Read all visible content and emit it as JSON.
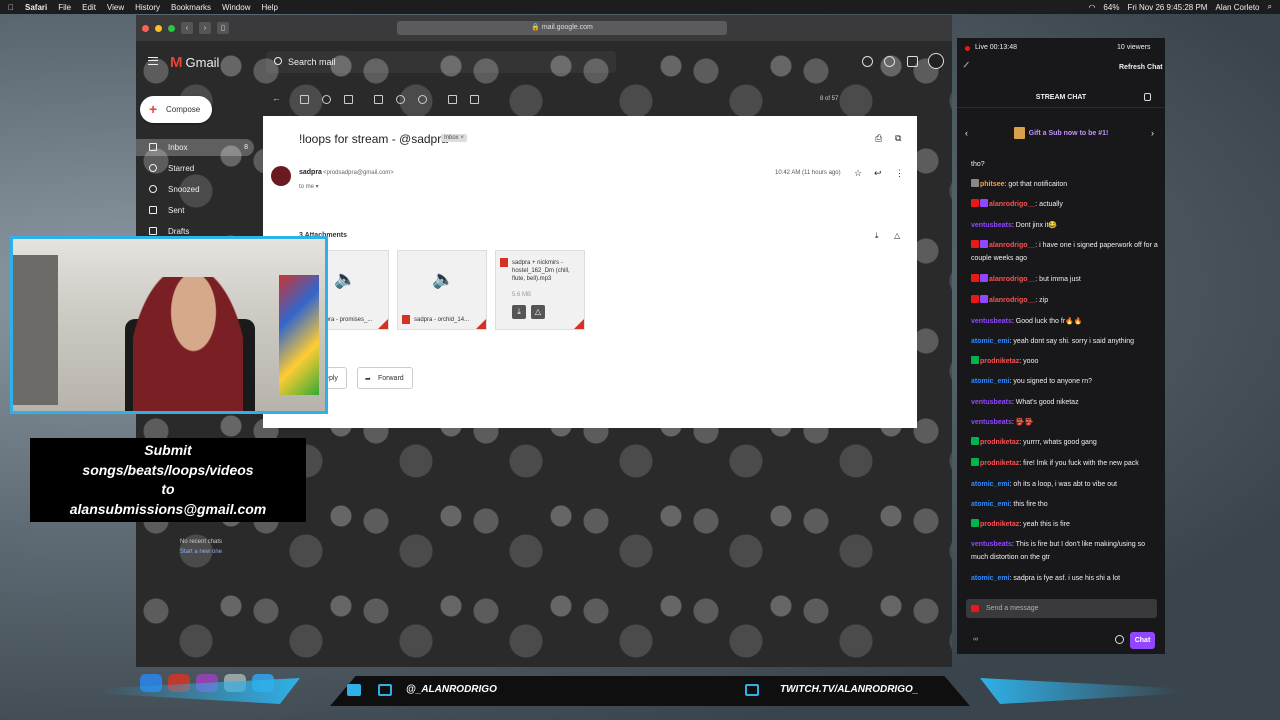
{
  "menubar": {
    "app": "Safari",
    "items": [
      "File",
      "Edit",
      "View",
      "History",
      "Bookmarks",
      "Window",
      "Help"
    ],
    "battery": "64%",
    "datetime": "Fri Nov 26  9:45:28 PM",
    "user": "Alan Corleto"
  },
  "safari": {
    "url": "mail.google.com"
  },
  "gmail": {
    "logo": "Gmail",
    "search_placeholder": "Search mail",
    "compose_label": "Compose",
    "nav": [
      {
        "label": "Inbox",
        "count": "8"
      },
      {
        "label": "Starred"
      },
      {
        "label": "Snoozed"
      },
      {
        "label": "Sent"
      },
      {
        "label": "Drafts"
      }
    ],
    "pagination": "8 of 57",
    "message": {
      "subject": "!loops for stream - @sadpra",
      "badge": "Inbox ×",
      "sender_name": "sadpra",
      "sender_email": "<prodsadpra@gmail.com>",
      "to": "to me ▾",
      "timestamp": "10:42 AM (11 hours ago)",
      "attachments_header": "3 Attachments",
      "attachments": [
        {
          "label": "sadpra - promises_..."
        },
        {
          "label": "sadpra - orchid_14..."
        },
        {
          "title": "sadpra + nickmirs - hostel_162_Dm (chill, flute, bell).mp3",
          "size": "5.6 MB"
        }
      ],
      "reply_label": "Reply",
      "forward_label": "Forward"
    },
    "chats": {
      "none": "No recent chats",
      "start": "Start a new one"
    }
  },
  "overlay": {
    "submit_lines": [
      "Submit",
      "songs/beats/loops/videos",
      "to",
      "alansubmissions@gmail.com"
    ],
    "twitter": "@_ALANRODRIGO",
    "twitch": "TWITCH.TV/ALANRODRIGO_"
  },
  "chat": {
    "live_time": "Live 00:13:48",
    "viewers": "10 viewers",
    "refresh": "Refresh Chat",
    "header": "STREAM CHAT",
    "sub_banner": "Gift a Sub now to be #1!",
    "messages": [
      {
        "user": "",
        "text": "tho?",
        "color": "#efeff1",
        "badges": []
      },
      {
        "user": "phitsee",
        "text": ": got that notificaiton",
        "color": "#ff9e3d",
        "badges": [
          "gray"
        ]
      },
      {
        "user": "alanrodrigo__",
        "text": ": actually",
        "color": "#ff4f4f",
        "badges": [
          "red",
          "purple"
        ]
      },
      {
        "user": "ventusbeats",
        "text": ": Dont jinx it😂",
        "color": "#9147ff",
        "badges": []
      },
      {
        "user": "alanrodrigo__",
        "text": ": i have one i signed paperwork off for a couple weeks ago",
        "color": "#ff4f4f",
        "badges": [
          "red",
          "purple"
        ]
      },
      {
        "user": "alanrodrigo__",
        "text": ": but imma just",
        "color": "#ff4f4f",
        "badges": [
          "red",
          "purple"
        ]
      },
      {
        "user": "alanrodrigo__",
        "text": ": zip",
        "color": "#ff4f4f",
        "badges": [
          "red",
          "purple"
        ]
      },
      {
        "user": "ventusbeats",
        "text": ": Good luck tho fr🔥🔥",
        "color": "#9147ff",
        "badges": []
      },
      {
        "user": "atomic_emi",
        "text": ": yeah dont say shi. sorry i said anything",
        "color": "#2e8bff",
        "badges": []
      },
      {
        "user": "prodniketaz",
        "text": ": yooo",
        "color": "#ff4f4f",
        "badges": [
          "green"
        ]
      },
      {
        "user": "atomic_emi",
        "text": ": you signed to anyone rn?",
        "color": "#2e8bff",
        "badges": []
      },
      {
        "user": "ventusbeats",
        "text": ": What's good niketaz",
        "color": "#9147ff",
        "badges": []
      },
      {
        "user": "ventusbeats",
        "text": ": 👺👺",
        "color": "#9147ff",
        "badges": []
      },
      {
        "user": "prodniketaz",
        "text": ": yurrrr, whats good gang",
        "color": "#ff4f4f",
        "badges": [
          "green"
        ]
      },
      {
        "user": "prodniketaz",
        "text": ": fire! lmk if you fuck with the new pack",
        "color": "#ff4f4f",
        "badges": [
          "green"
        ]
      },
      {
        "user": "atomic_emi",
        "text": ": oh its a loop, i was abt to vibe out",
        "color": "#2e8bff",
        "badges": []
      },
      {
        "user": "atomic_emi",
        "text": ": this fire tho",
        "color": "#2e8bff",
        "badges": []
      },
      {
        "user": "prodniketaz",
        "text": ": yeah this is fire",
        "color": "#ff4f4f",
        "badges": [
          "green"
        ]
      },
      {
        "user": "ventusbeats",
        "text": ": This is fire but I don't like making/using so much distortion on the gtr",
        "color": "#9147ff",
        "badges": []
      },
      {
        "user": "atomic_emi",
        "text": ": sadpra is fye asf. i use his shi a lot",
        "color": "#2e8bff",
        "badges": []
      }
    ],
    "input_placeholder": "Send a message",
    "points": "∞",
    "chat_button": "Chat"
  }
}
